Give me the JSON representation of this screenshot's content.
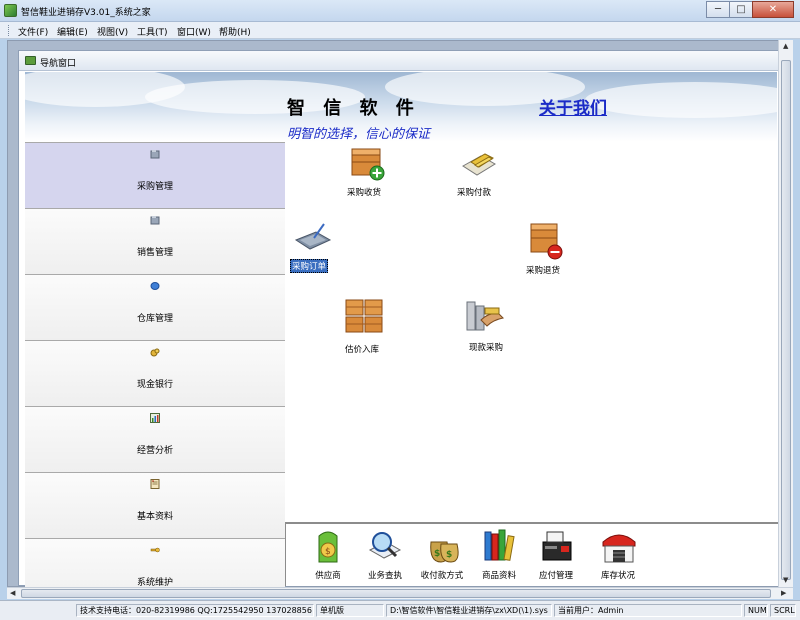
{
  "window": {
    "title": "智信鞋业进销存V3.01_系统之家",
    "min": "─",
    "max": "□",
    "close": "✕"
  },
  "menu": [
    "文件(F)",
    "编辑(E)",
    "视图(V)",
    "工具(T)",
    "窗口(W)",
    "帮助(H)"
  ],
  "child_window": {
    "title": "导航窗口"
  },
  "banner": {
    "title": "智 信 软 件",
    "about": "关于我们",
    "slogan": "明智的选择，信心的保证"
  },
  "nav": [
    {
      "label": "采购管理",
      "icon": "folder-icon",
      "active": true
    },
    {
      "label": "销售管理",
      "icon": "folder-icon"
    },
    {
      "label": "仓库管理",
      "icon": "warehouse-icon"
    },
    {
      "label": "现金银行",
      "icon": "money-icon"
    },
    {
      "label": "经营分析",
      "icon": "chart-icon"
    },
    {
      "label": "基本资料",
      "icon": "document-icon"
    },
    {
      "label": "系统维护",
      "icon": "key-icon"
    }
  ],
  "functions": {
    "purchase_receipt": "采购收货",
    "purchase_payment": "采购付款",
    "purchase_order": "采购订单",
    "purchase_return": "采购退货",
    "estimate_stockin": "估价入库",
    "cash_purchase": "现款采购"
  },
  "toolbar": [
    "供应商",
    "业务查执",
    "收付款方式",
    "商品资料",
    "应付管理",
    "库存状况"
  ],
  "status": {
    "support": "技术支持电话：020-82319986 QQ:1725542950 137028856",
    "mode": "单机版",
    "path": "D:\\智信软件\\智信鞋业进销存\\zx\\XD(\\1).sys",
    "user": "当前用户：Admin",
    "num": "NUM",
    "scrl": "SCRL"
  },
  "colors": {
    "link": "#1b2bc7",
    "nav_active": "#d5d5ee",
    "selection": "#3a6ec0"
  }
}
